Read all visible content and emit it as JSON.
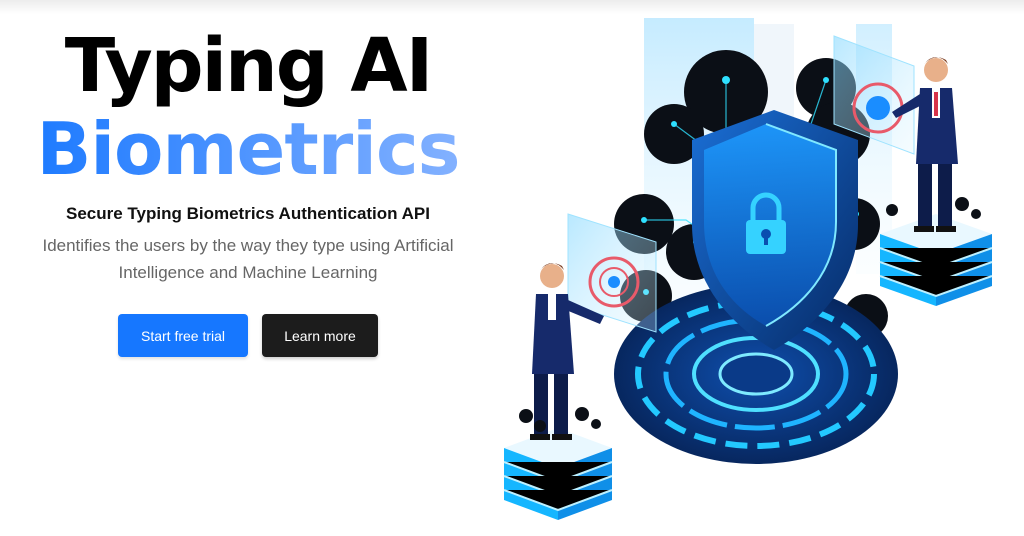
{
  "hero": {
    "title_line1": "Typing AI",
    "title_line2": "Biometrics",
    "subtitle": "Secure Typing Biometrics Authentication API",
    "description": "Identifies the users by the way they type using Artificial Intelligence and Machine Learning"
  },
  "buttons": {
    "primary_label": "Start free trial",
    "secondary_label": "Learn more"
  },
  "colors": {
    "accent": "#1677ff",
    "dark_button": "#1c1c1c",
    "illustration_blue": "#0b3a8a",
    "illustration_cyan": "#1ec8ff"
  },
  "illustration": {
    "icons": [
      "shield-lock-icon",
      "fingerprint-icon",
      "circuit-node-icon"
    ]
  }
}
